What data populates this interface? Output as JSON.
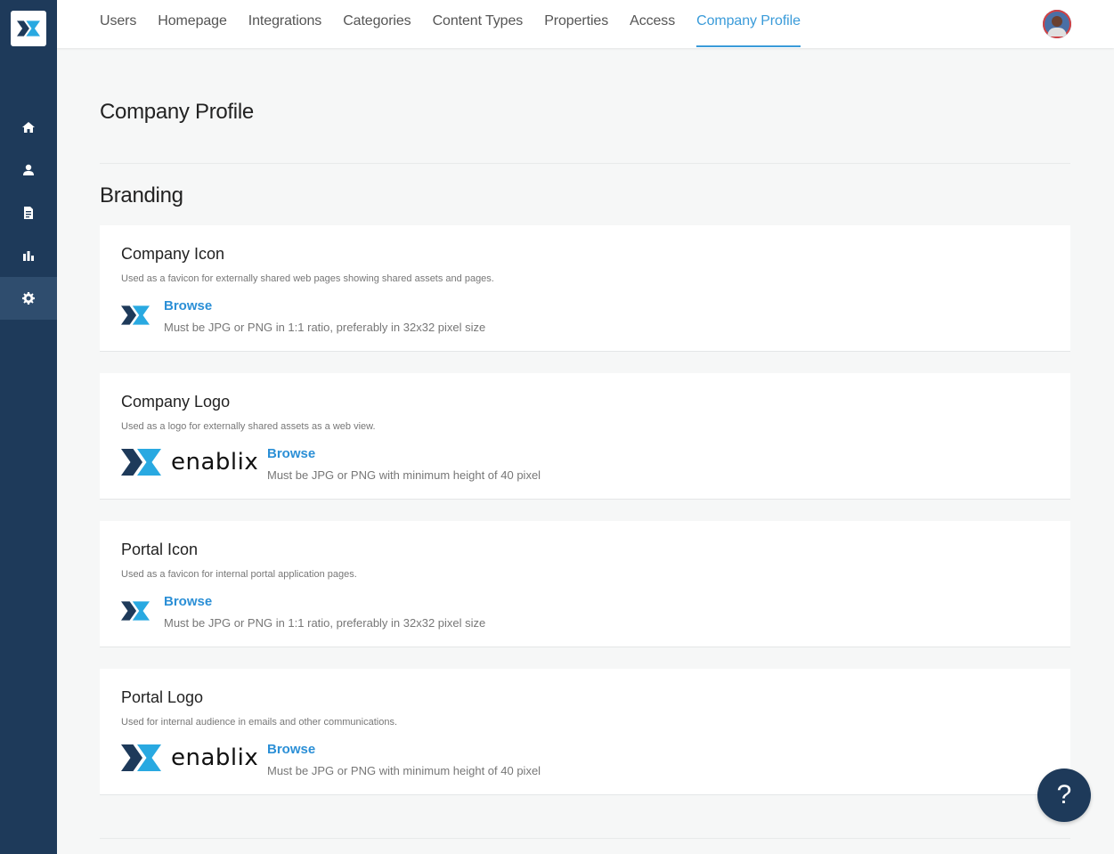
{
  "nav": {
    "tabs": [
      {
        "label": "Users"
      },
      {
        "label": "Homepage"
      },
      {
        "label": "Integrations"
      },
      {
        "label": "Categories"
      },
      {
        "label": "Content Types"
      },
      {
        "label": "Properties"
      },
      {
        "label": "Access"
      },
      {
        "label": "Company Profile",
        "active": true
      }
    ]
  },
  "sidebar": {
    "items": [
      {
        "icon": "home-icon"
      },
      {
        "icon": "user-icon"
      },
      {
        "icon": "document-icon"
      },
      {
        "icon": "bar-chart-icon"
      },
      {
        "icon": "gear-icon",
        "active": true
      }
    ]
  },
  "page": {
    "title": "Company Profile",
    "section_title": "Branding"
  },
  "cards": [
    {
      "title": "Company Icon",
      "description": "Used as a favicon for externally shared web pages showing shared assets and pages.",
      "browse_label": "Browse",
      "hint": "Must be JPG or PNG in 1:1 ratio, preferably in 32x32 pixel size"
    },
    {
      "title": "Company Logo",
      "description": "Used as a logo for externally shared assets as a web view.",
      "browse_label": "Browse",
      "hint": "Must be JPG or PNG with minimum height of 40 pixel",
      "logo_text": "enablix"
    },
    {
      "title": "Portal Icon",
      "description": "Used as a favicon for internal portal application pages.",
      "browse_label": "Browse",
      "hint": "Must be JPG or PNG in 1:1 ratio, preferably in 32x32 pixel size"
    },
    {
      "title": "Portal Logo",
      "description": "Used for internal audience in emails and other communications.",
      "browse_label": "Browse",
      "hint": "Must be JPG or PNG with minimum height of 40 pixel",
      "logo_text": "enablix"
    }
  ],
  "help": {
    "label": "?"
  },
  "colors": {
    "sidebar": "#1e3a5a",
    "accent": "#3a9bd9",
    "link": "#2b8fd6",
    "logo_dark": "#1e3a5a",
    "logo_light": "#29a9e1"
  }
}
